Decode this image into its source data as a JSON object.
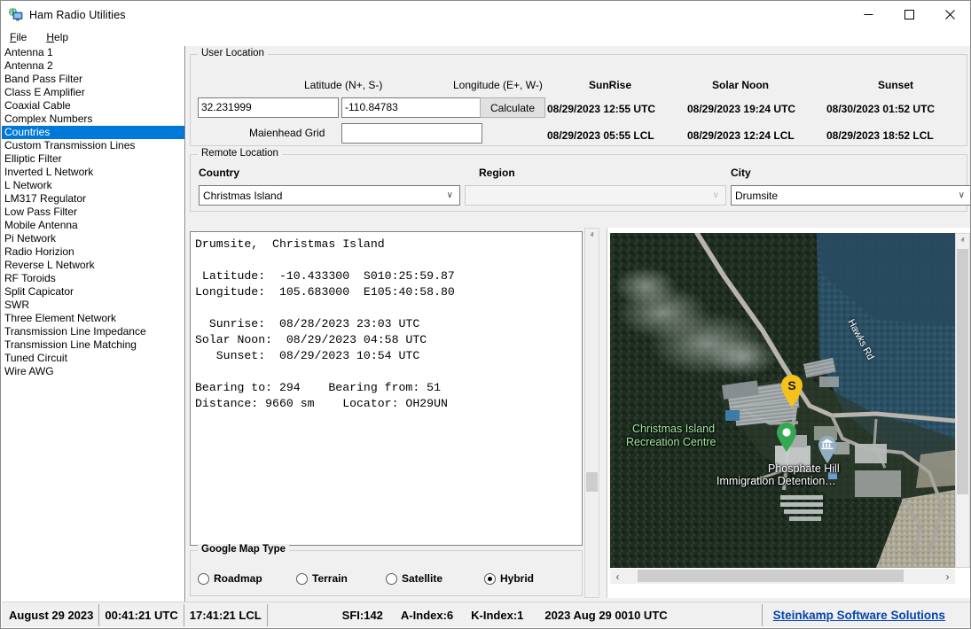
{
  "window": {
    "title": "Ham Radio Utilities",
    "icon": "globe-monitor-icon",
    "minimize": "—",
    "maximize": "□",
    "close": "✕"
  },
  "menubar": {
    "items": [
      {
        "label": "File",
        "mnemonic": "F"
      },
      {
        "label": "Help",
        "mnemonic": "H"
      }
    ]
  },
  "sidebar": {
    "selected": "Countries",
    "items": [
      "Antenna 1",
      "Antenna 2",
      "Band Pass Filter",
      "Class E Amplifier",
      "Coaxial Cable",
      "Complex Numbers",
      "Countries",
      "Custom Transmission Lines",
      "Elliptic Filter",
      "Inverted L Network",
      "L Network",
      "LM317 Regulator",
      "Low Pass Filter",
      "Mobile Antenna",
      "Pi Network",
      "Radio Horizion",
      "Reverse L Network",
      "RF Toroids",
      "Split Capicator",
      "SWR",
      "Three Element Network",
      "Transmission Line Impedance",
      "Transmission Line Matching",
      "Tuned Circuit",
      "Wire AWG"
    ]
  },
  "user_location": {
    "group_title": "User Location",
    "latitude_label": "Latitude (N+, S-)",
    "longitude_label": "Longitude (E+, W-)",
    "latitude_value": "32.231999",
    "longitude_value": "-110.84783",
    "maidenhead_label": "Maienhead Grid",
    "maidenhead_value": "",
    "maidenhead_placeholder": "",
    "calculate_button": "Calculate",
    "sun": {
      "headers": [
        "SunRise",
        "Solar Noon",
        "Sunset"
      ],
      "utc": [
        "08/29/2023 12:55 UTC",
        "08/29/2023 19:24 UTC",
        "08/30/2023 01:52 UTC"
      ],
      "lcl": [
        "08/29/2023 05:55 LCL",
        "08/29/2023 12:24 LCL",
        "08/29/2023 18:52 LCL"
      ]
    }
  },
  "remote_location": {
    "group_title": "Remote Location",
    "country_label": "Country",
    "region_label": "Region",
    "city_label": "City",
    "country_value": "Christmas Island",
    "region_value": "",
    "city_value": "Drumsite",
    "carat": "∨"
  },
  "info": {
    "text": "Drumsite,  Christmas Island\n\n Latitude:  -10.433300  S010:25:59.87\nLongitude:  105.683000  E105:40:58.80\n\n  Sunrise:  08/28/2023 23:03 UTC\nSolar Noon:  08/29/2023 04:58 UTC\n   Sunset:  08/29/2023 10:54 UTC\n\nBearing to: 294    Bearing from: 51\nDistance: 9660 sm    Locator: OH29UN"
  },
  "map_type": {
    "group_title": "Google Map Type",
    "options": [
      {
        "label": "Roadmap",
        "selected": false
      },
      {
        "label": "Terrain",
        "selected": false
      },
      {
        "label": "Satellite",
        "selected": false
      },
      {
        "label": "Hybrid",
        "selected": true
      }
    ]
  },
  "map": {
    "labels": [
      {
        "text": "Hawks Rd",
        "style": "road"
      },
      {
        "text": "Christmas Island",
        "style": "green"
      },
      {
        "text": "Recreation Centre",
        "style": "green"
      },
      {
        "text": "Phosphate Hill",
        "style": "white"
      },
      {
        "text": "Immigration Detention…",
        "style": "white"
      }
    ],
    "markers": [
      {
        "name": "start-pin",
        "label": "S",
        "color": "#f5c21b"
      },
      {
        "name": "place-pin",
        "label": "",
        "color": "#34a853"
      },
      {
        "name": "museum-pin",
        "label": "ᴿ",
        "color": "#8ba7bd"
      }
    ],
    "scroll_left": "‹",
    "scroll_right": "›",
    "scroll_up": "ⱏ",
    "scroll_down": "ⱟ"
  },
  "statusbar": {
    "date": "August 29 2023",
    "utc_time": "00:41:21 UTC",
    "local_time": "17:41:21 LCL",
    "sfi": "SFI:142",
    "a_index": "A-Index:6",
    "k_index": "K-Index:1",
    "stamp": "2023 Aug 29 0010 UTC",
    "link": "Steinkamp Software Solutions"
  },
  "colors": {
    "selection": "#0078d7",
    "link": "#0645ad",
    "panel": "#f0f0f0"
  }
}
